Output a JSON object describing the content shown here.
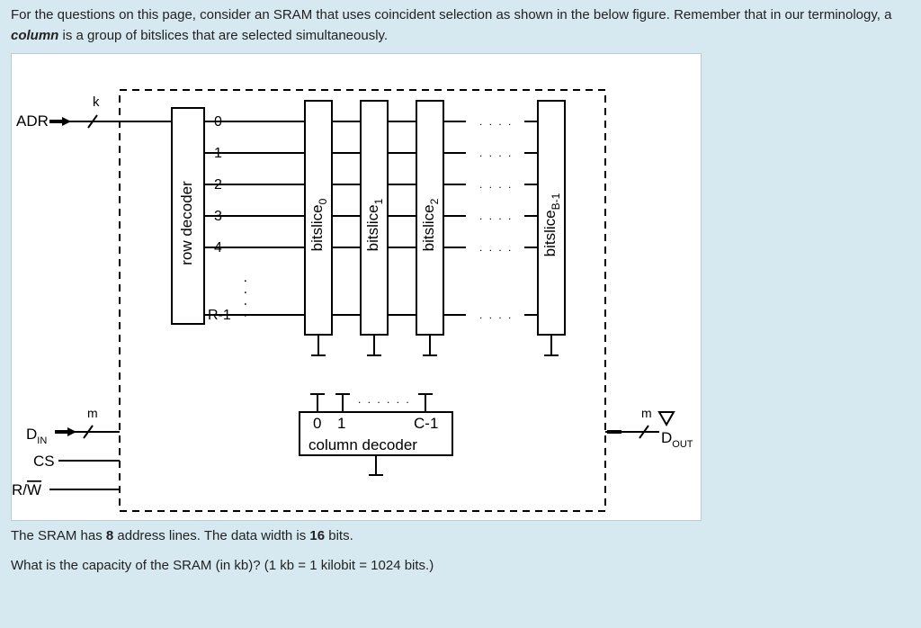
{
  "intro": {
    "part1": "For the questions on this page, consider an SRAM that uses coincident selection as shown in the below figure. Remember that in our terminology, a ",
    "boldItalic": "column",
    "part2": " is a group of bitslices that are selected simultaneously."
  },
  "signals": {
    "adr": "ADR",
    "adr_bits": "k",
    "din": "D",
    "din_sub": "IN",
    "din_bits": "m",
    "cs": "CS",
    "rw_r": "R/",
    "rw_w": "W",
    "dout": "D",
    "dout_sub": "OUT",
    "dout_bits": "m"
  },
  "rowdecoder": {
    "label": "row decoder",
    "outputs": [
      "0",
      "1",
      "2",
      "3",
      "4",
      "R-1"
    ]
  },
  "bitslices": [
    "bitslice",
    "bitslice",
    "bitslice",
    "bitslice"
  ],
  "bitslice_sub": [
    "0",
    "1",
    "2",
    "B-1"
  ],
  "coldecoder": {
    "label": "column decoder",
    "inputs": [
      "0",
      "1",
      "C-1"
    ]
  },
  "params": {
    "prefix": "The SRAM has ",
    "addr_lines": "8",
    "mid": " address lines. The data width is ",
    "data_width": "16",
    "suffix": " bits."
  },
  "question": "What is the capacity of the SRAM (in kb)? (1 kb = 1 kilobit = 1024 bits.)"
}
